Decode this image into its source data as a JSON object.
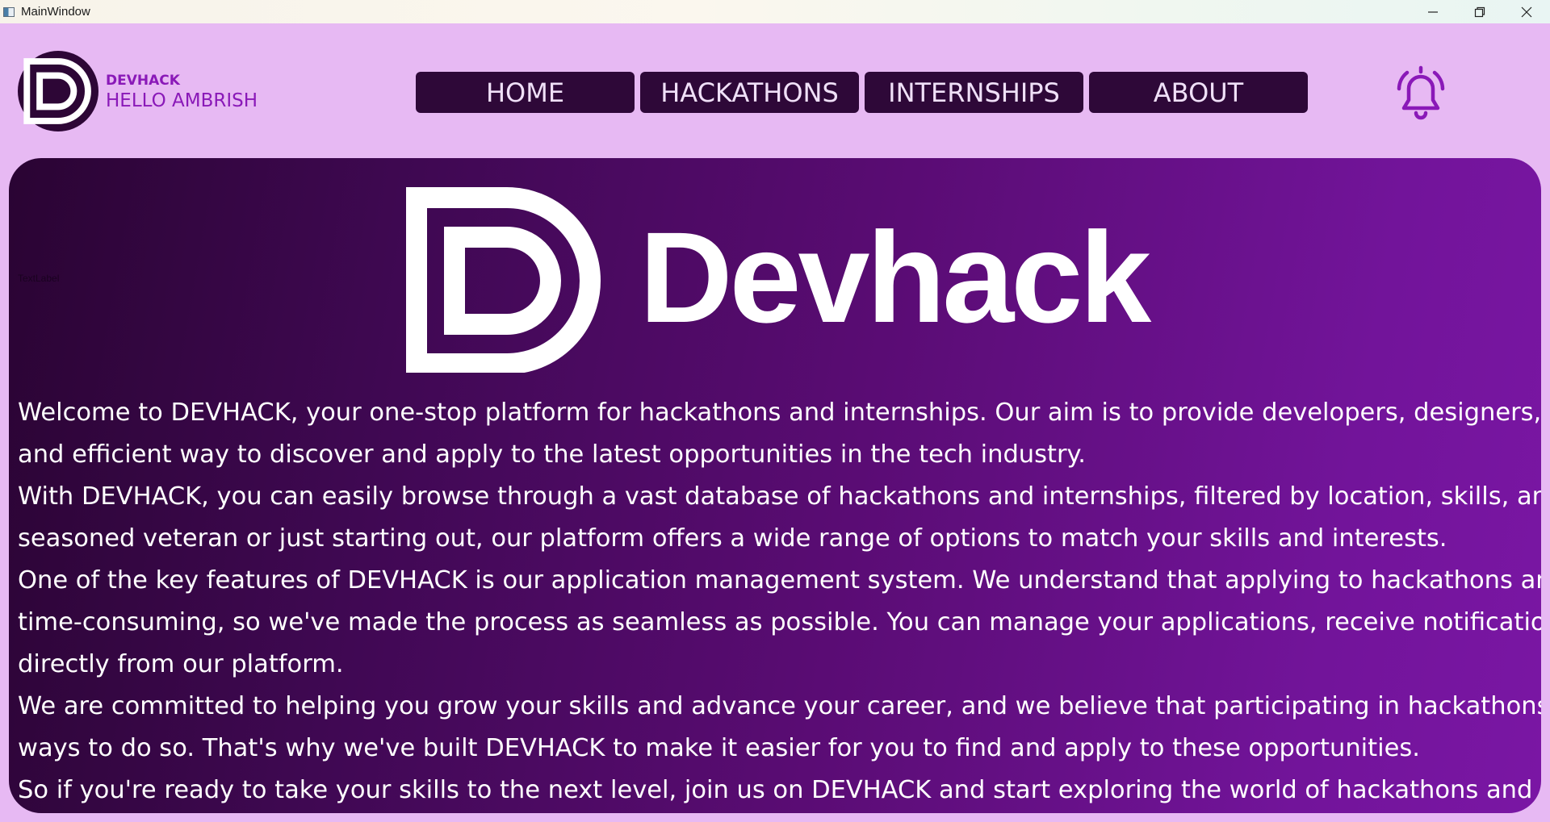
{
  "window": {
    "title": "MainWindow"
  },
  "header": {
    "brand": "DEVHACK",
    "greeting": "HELLO AMBRISH"
  },
  "nav": {
    "items": [
      "HOME",
      "HACKATHONS",
      "INTERNSHIPS",
      "ABOUT"
    ]
  },
  "main": {
    "text_label": "TextLabel",
    "hero_word": "Devhack",
    "lines": [
      "Welcome to DEVHACK, your one-stop platform for hackathons and internships. Our aim is to provide developers, designers, and e",
      "and efficient way to discover and apply to the latest opportunities in the tech industry.",
      "With DEVHACK, you can easily browse through a vast database of hackathons and internships, filtered by location, skills, and indu",
      "seasoned veteran or just starting out, our platform offers a wide range of options to match your skills and interests.",
      "One of the key features of DEVHACK is our application management system. We understand that applying to hackathons and inte",
      "time-consuming, so we've made the process as seamless as possible. You can manage your applications, receive notifications, and",
      "directly from our platform.",
      "We are committed to helping you grow your skills and advance your career, and we believe that participating in hackathons and in",
      "ways to do so. That's why we've built DEVHACK to make it easier for you to find and apply to these opportunities.",
      "So if you're ready to take your skills to the next level, join us on DEVHACK and start exploring the world of hackathons and interns"
    ]
  },
  "colors": {
    "background": "#e7b9f3",
    "accent": "#8a19b8",
    "nav_button": "#2e0838",
    "panel_start": "#2a0433",
    "panel_end": "#7a16a4"
  }
}
